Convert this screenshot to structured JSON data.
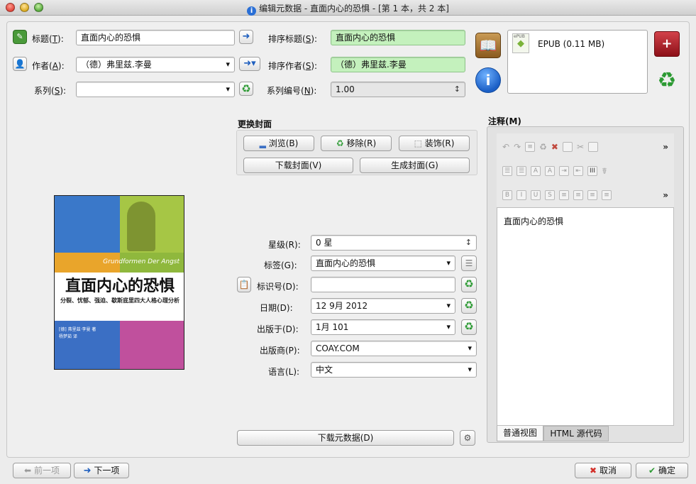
{
  "window": {
    "title": "编辑元数据 - 直面内心的恐惧 - [第 1 本，共 2 本]"
  },
  "fields": {
    "title_label": "标题(",
    "title_key": "T",
    "title_value": "直面内心的恐惧",
    "author_label": "作者(",
    "author_key": "A",
    "author_value": "（德）弗里兹.李曼",
    "series_label": "系列(",
    "series_key": "S",
    "series_value": "",
    "sort_title_label": "排序标题(",
    "sort_title_key": "S",
    "sort_title_value": "直面内心的恐惧",
    "sort_author_label": "排序作者(",
    "sort_author_key": "S",
    "sort_author_value": "（德）弗里兹.李曼",
    "series_index_label": "系列编号(",
    "series_index_key": "N",
    "series_index_value": "1.00",
    "close_paren": "):"
  },
  "formats": {
    "item_label": "EPUB (0.11 MB)",
    "badge": "ePUB"
  },
  "cover": {
    "section_label": "更换封面",
    "browse": "浏览(B)",
    "remove": "移除(R)",
    "trim": "装饰(R)",
    "download": "下载封面(V)",
    "generate": "生成封面(G)",
    "book_title": "直面内心的恐惧",
    "book_subtitle": "分裂、忧郁、强迫、歇斯底里四大人格心理分析",
    "book_german": "Grundformen Der Angst",
    "book_author": "[德] 弗里兹·李曼 著",
    "book_translator": "杨梦茹 译"
  },
  "meta": {
    "rating_label": "星级(R):",
    "rating_value": "0 星",
    "tags_label": "标签(G):",
    "tags_value": "直面内心的恐惧",
    "ids_label": "标识号(D):",
    "ids_value": "",
    "date_label": "日期(D):",
    "date_value": "12 9月 2012",
    "published_label": "出版于(D):",
    "published_value": "1月 101",
    "publisher_label": "出版商(P):",
    "publisher_value": "COAY.COM",
    "language_label": "语言(L):",
    "language_value": "中文"
  },
  "notes": {
    "label": "注释(M)",
    "content": "直面内心的恐惧",
    "tab_normal": "普通视图",
    "tab_html": "HTML 源代码"
  },
  "download_metadata": "下载元数据(D)",
  "footer": {
    "prev": "前一项",
    "next": "下一项",
    "cancel": "取消",
    "ok": "确定"
  },
  "colors": {
    "green_field": "#c4f1bd",
    "accent_blue": "#1f5fbf"
  }
}
